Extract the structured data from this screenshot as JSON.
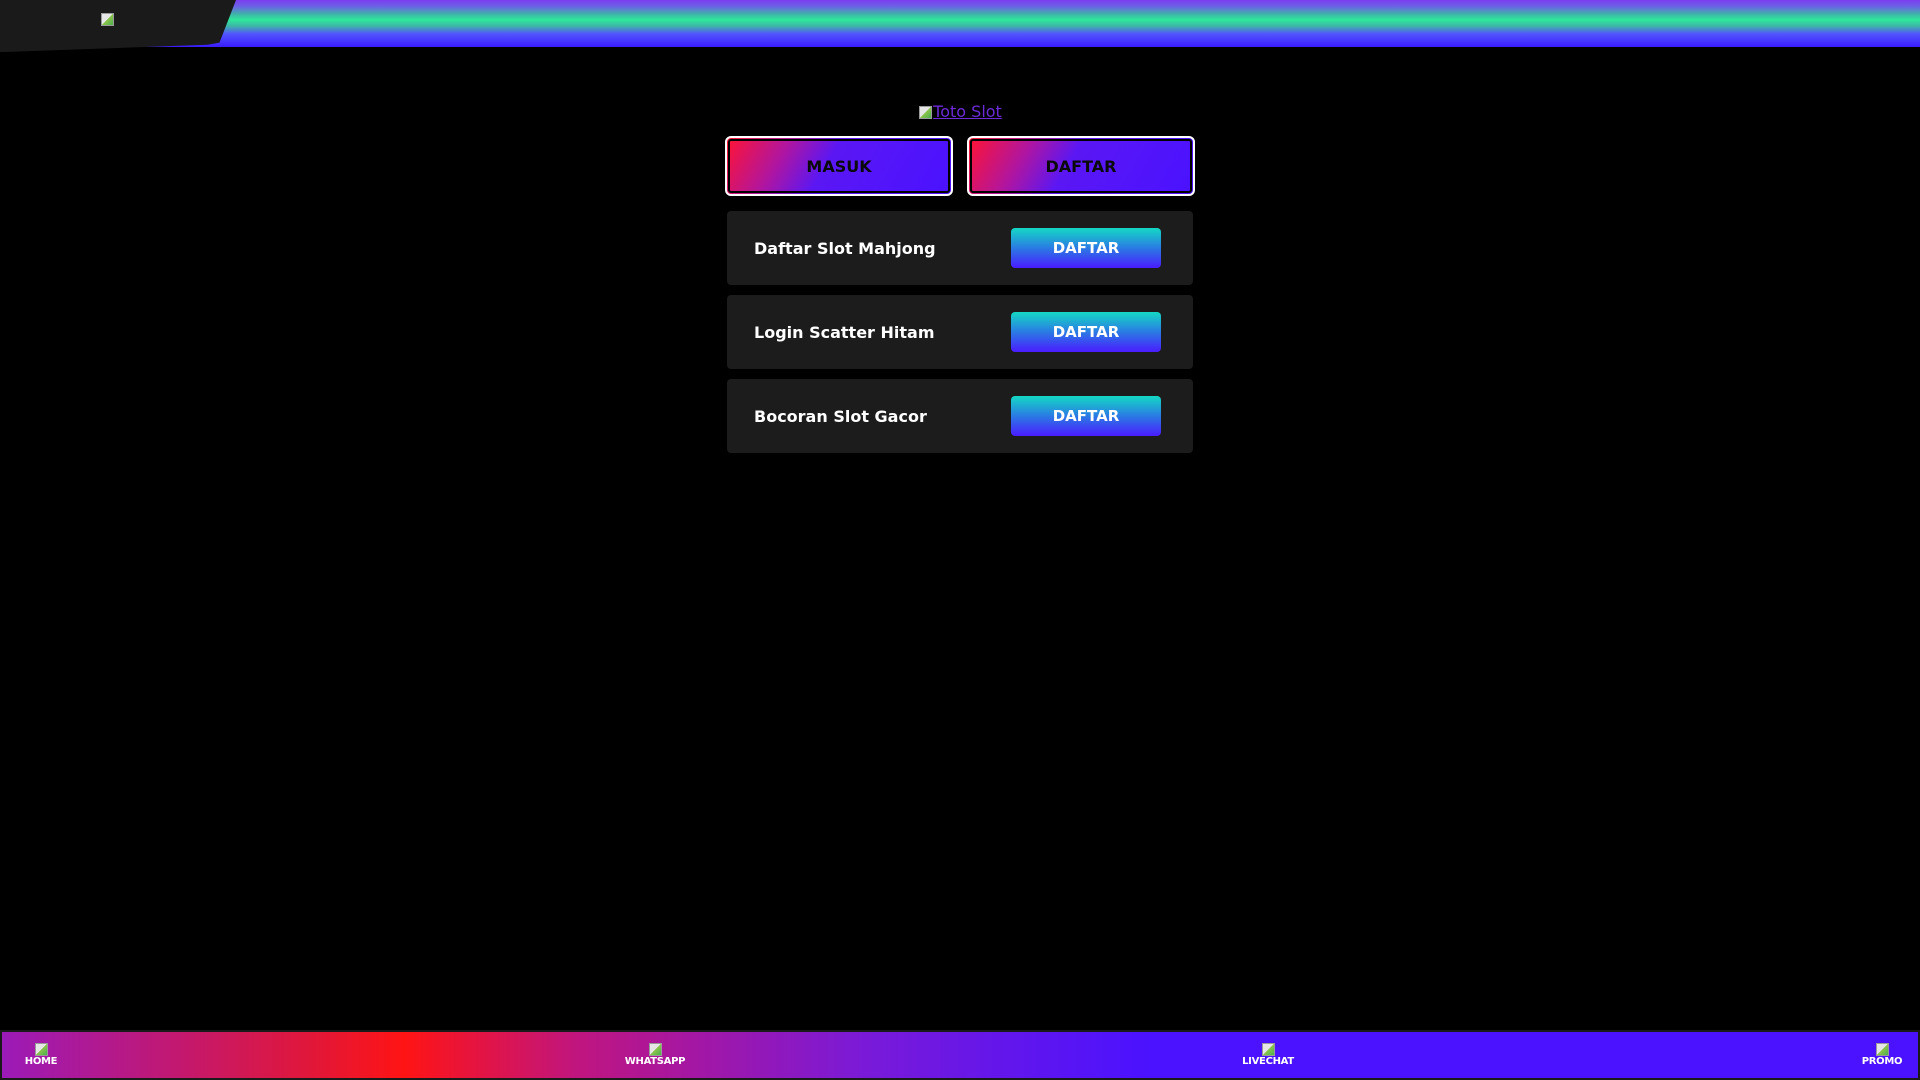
{
  "header": {
    "logo_icon": "broken-image-icon"
  },
  "main": {
    "site_logo_alt": "Toto Slot",
    "auth": {
      "login_label": "MASUK",
      "register_label": "DAFTAR"
    },
    "links": [
      {
        "label": "Daftar Slot Mahjong",
        "button": "DAFTAR"
      },
      {
        "label": "Login Scatter Hitam",
        "button": "DAFTAR"
      },
      {
        "label": "Bocoran Slot Gacor",
        "button": "DAFTAR"
      }
    ]
  },
  "bottom_nav": {
    "items": [
      {
        "label": "HOME",
        "icon": "broken-image-icon"
      },
      {
        "label": "WHATSAPP",
        "icon": "broken-image-icon"
      },
      {
        "label": "LIVECHAT",
        "icon": "broken-image-icon"
      },
      {
        "label": "PROMO",
        "icon": "broken-image-icon"
      }
    ]
  },
  "colors": {
    "background": "#000000",
    "card": "#1c1c1c",
    "accent_purple": "#4a12ff",
    "accent_red": "#ff1433",
    "accent_teal": "#14d9c4",
    "link_purple": "#6b2bd9"
  }
}
